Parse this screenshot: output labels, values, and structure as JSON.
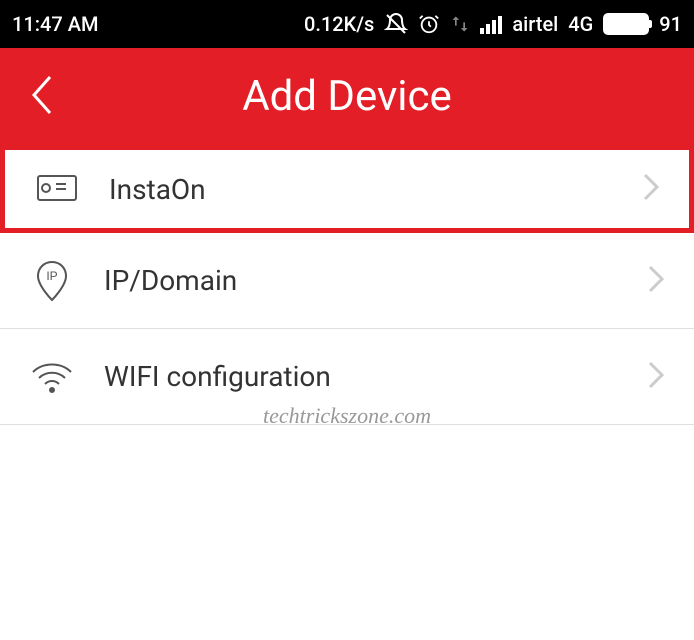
{
  "statusBar": {
    "time": "11:47 AM",
    "dataSpeed": "0.12K/s",
    "carrier": "airtel",
    "network": "4G",
    "battery": "91"
  },
  "header": {
    "title": "Add Device"
  },
  "menu": {
    "items": [
      {
        "label": "InstaOn"
      },
      {
        "label": "IP/Domain"
      },
      {
        "label": "WIFI configuration"
      }
    ]
  },
  "watermark": "techtrickszone.com"
}
